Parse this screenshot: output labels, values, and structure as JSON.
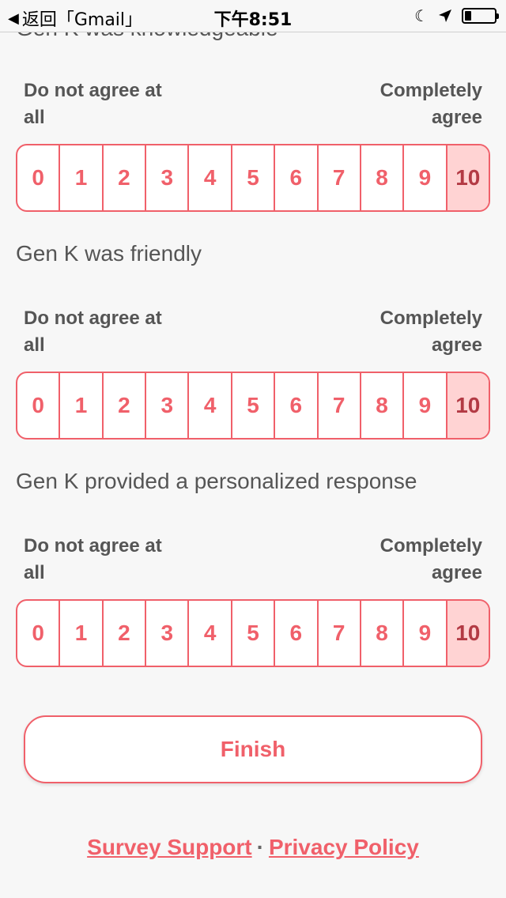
{
  "status_bar": {
    "back_app": "返回「Gmail」",
    "time": "下午8:51",
    "battery_level": 0.2
  },
  "questions": [
    {
      "text": "Gen K was knowledgeable",
      "left_label": "Do not agree at all",
      "right_label": "Completely agree",
      "options": [
        "0",
        "1",
        "2",
        "3",
        "4",
        "5",
        "6",
        "7",
        "8",
        "9",
        "10"
      ],
      "selected": "10"
    },
    {
      "text": "Gen K was friendly",
      "left_label": "Do not agree at all",
      "right_label": "Completely agree",
      "options": [
        "0",
        "1",
        "2",
        "3",
        "4",
        "5",
        "6",
        "7",
        "8",
        "9",
        "10"
      ],
      "selected": "10"
    },
    {
      "text": "Gen K provided a personalized response",
      "left_label": "Do not agree at all",
      "right_label": "Completely agree",
      "options": [
        "0",
        "1",
        "2",
        "3",
        "4",
        "5",
        "6",
        "7",
        "8",
        "9",
        "10"
      ],
      "selected": "10"
    }
  ],
  "finish_label": "Finish",
  "footer": {
    "support_label": "Survey Support",
    "separator": "·",
    "privacy_label": "Privacy Policy"
  },
  "colors": {
    "accent": "#f0606a",
    "selected_bg": "#ffd3d3",
    "background": "#f7f7f7"
  }
}
